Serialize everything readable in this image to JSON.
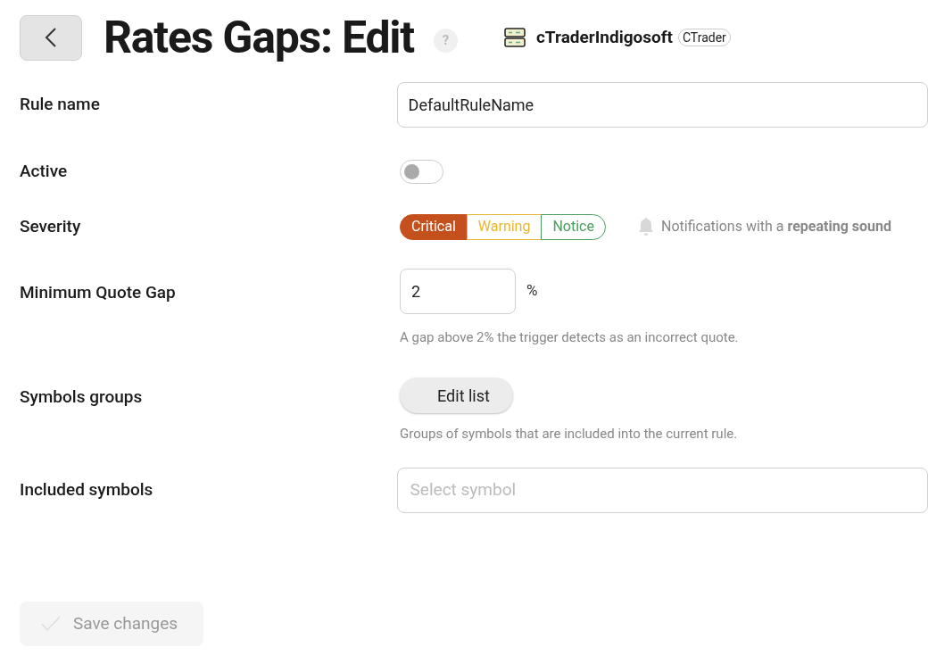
{
  "header": {
    "title": "Rates Gaps: Edit",
    "help": "?",
    "server": "cTraderIndigosoft",
    "server_tag": "CTrader"
  },
  "fields": [
    {
      "kind": "text",
      "label": "Rule name",
      "value": "DefaultRuleName"
    },
    {
      "kind": "toggle",
      "label": "Active",
      "on": false
    },
    {
      "kind": "severity",
      "label": "Severity",
      "options": [
        {
          "label": "Critical",
          "selected": true,
          "color": "#c4501e"
        },
        {
          "label": "Warning",
          "selected": false,
          "color": "#e8b730"
        },
        {
          "label": "Notice",
          "selected": false,
          "color": "#4a9e5e"
        }
      ],
      "note": "Notifications with a **repeating sound**"
    },
    {
      "kind": "number",
      "label": "Minimum Quote Gap",
      "value": "2",
      "unit": "%",
      "hint": "A gap above 2% the trigger detects as an incorrect quote."
    },
    {
      "kind": "button",
      "label": "Symbols groups",
      "button": "Edit list",
      "hint": "Groups of symbols that are included into the current rule."
    },
    {
      "kind": "select",
      "label": "Included symbols",
      "placeholder": "Select symbol"
    }
  ],
  "save": {
    "label": "Save changes",
    "disabled": true
  }
}
